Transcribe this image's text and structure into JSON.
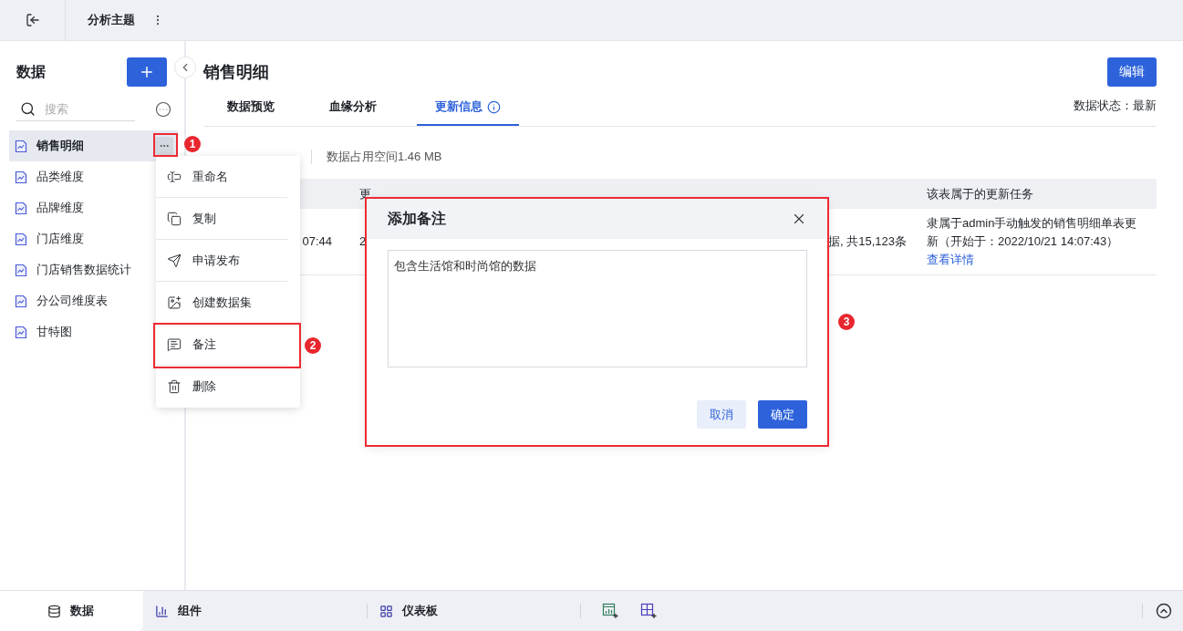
{
  "top_bar": {
    "title": "分析主题"
  },
  "sidebar": {
    "title": "数据",
    "search": {
      "placeholder": "搜索"
    },
    "items": [
      {
        "label": "销售明细",
        "selected": true
      },
      {
        "label": "品类维度",
        "selected": false
      },
      {
        "label": "品牌维度",
        "selected": false
      },
      {
        "label": "门店维度",
        "selected": false
      },
      {
        "label": "门店销售数据统计",
        "selected": false
      },
      {
        "label": "分公司维度表",
        "selected": false
      },
      {
        "label": "甘特图",
        "selected": false
      }
    ]
  },
  "main": {
    "title": "销售明细",
    "edit_button": "编辑",
    "tabs": [
      {
        "label": "数据预览",
        "selected": false
      },
      {
        "label": "血缘分析",
        "selected": false
      },
      {
        "label": "更新信息",
        "selected": true
      }
    ],
    "status": "数据状态：最新",
    "info": "数据占用空间1.46 MB",
    "table": {
      "columns": {
        "column_2": "更",
        "column_4": "该表属于的更新任务"
      },
      "rows": [
        {
          "column_1": "07:44",
          "column_2": "2",
          "column_3": "据, 共15,123条",
          "column_4": "隶属于admin手动触发的销售明细单表更新（开始于：2022/10/21 14:07:43）",
          "link": "查看详情"
        }
      ]
    }
  },
  "context_menu": {
    "items": [
      {
        "label": "重命名",
        "kind": "rename"
      },
      {
        "label": "复制",
        "kind": "copy"
      },
      {
        "label": "申请发布",
        "kind": "publish"
      },
      {
        "label": "创建数据集",
        "kind": "dataset"
      },
      {
        "label": "备注",
        "kind": "note"
      },
      {
        "label": "删除",
        "kind": "delete"
      }
    ]
  },
  "dialog": {
    "title": "添加备注",
    "note": "包含生活馆和时尚馆的数据",
    "buttons": [
      {
        "label": "取消",
        "kind": "secondary"
      },
      {
        "label": "确定",
        "kind": "primary"
      }
    ]
  },
  "bottom_bar": {
    "tabs": [
      {
        "label": "数据",
        "selected": true,
        "kind": "data"
      },
      {
        "label": "组件",
        "selected": false,
        "kind": "component"
      },
      {
        "label": "仪表板",
        "selected": false,
        "kind": "dashboard"
      }
    ]
  },
  "annotations": [
    {
      "label": "1"
    },
    {
      "label": "2"
    },
    {
      "label": "3"
    }
  ]
}
